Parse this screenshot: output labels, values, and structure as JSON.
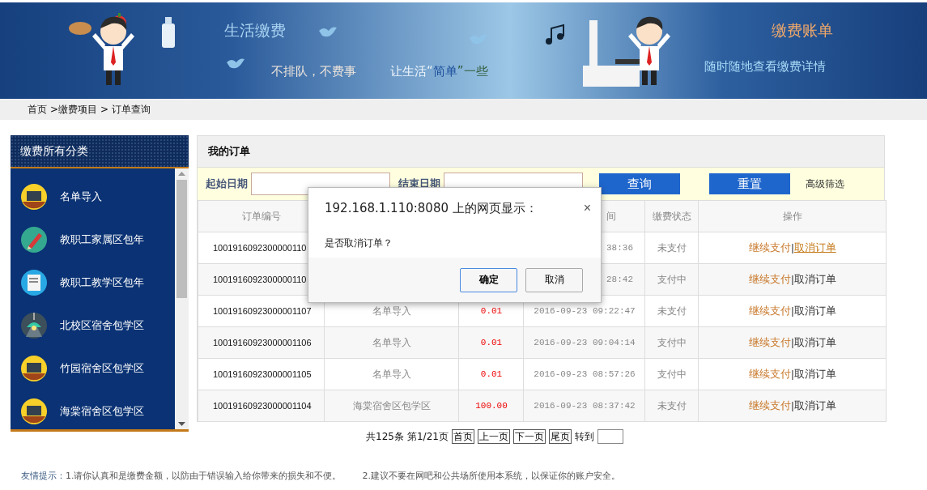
{
  "banner": {
    "title": "生活缴费",
    "slogan_1": "不排队，不费事",
    "slogan_2": [
      {
        "text": "让生活“",
        "color": "#eef4fb"
      },
      {
        "text": "简单",
        "color": "#1d4f9c"
      },
      {
        "text": "”一些",
        "color": "#2f5a36"
      }
    ],
    "right_title": "缴费账单",
    "right_subtitle": "随时随地查看缴费详情"
  },
  "breadcrumb": [
    "首页",
    ">缴费项目",
    ">",
    "订单查询"
  ],
  "sidebar": {
    "title": "缴费所有分类",
    "items": [
      {
        "label": "名单导入",
        "kind": "blackboard"
      },
      {
        "label": "教职工家属区包年",
        "kind": "pencil"
      },
      {
        "label": "教职工教学区包年",
        "kind": "document"
      },
      {
        "label": "北校区宿舍包学区",
        "kind": "lamp"
      },
      {
        "label": "竹园宿舍区包学区",
        "kind": "blackboard"
      },
      {
        "label": "海棠宿舍区包学区",
        "kind": "blackboard"
      }
    ]
  },
  "orders": {
    "title": "我的订单",
    "filter": {
      "start_label": "起始日期",
      "end_label": "结束日期",
      "search_button": "查询",
      "reset_button": "重置",
      "advanced": "高级筛选"
    },
    "columns": [
      {
        "label": "订单编号"
      },
      {},
      {},
      {
        "label": "间",
        "clipped": true
      },
      {
        "label": "缴费状态"
      },
      {
        "label": "操作"
      }
    ],
    "rows": [
      {
        "id": "1001916092300000110",
        "time": "38:36",
        "time_clipped": true,
        "status": "未支付",
        "separator": "|",
        "actions": [
          {
            "label": "继续支付",
            "hovered": false
          },
          {
            "label": "取消订单",
            "hovered": true
          }
        ]
      },
      {
        "id": "1001916092300000110",
        "time": "28:42",
        "time_clipped": true,
        "status": "支付中",
        "separator": "|",
        "actions": [
          {
            "label": "继续支付",
            "hovered": false
          },
          {
            "label": "取消订单",
            "hovered": false
          }
        ]
      },
      {
        "id": "10019160923000001107",
        "item": "名单导入",
        "amount": "0.01",
        "time": "2016-09-23 09:22:47",
        "status": "未支付",
        "separator": "|",
        "actions": [
          {
            "label": "继续支付",
            "hovered": false
          },
          {
            "label": "取消订单",
            "hovered": false
          }
        ]
      },
      {
        "id": "10019160923000001106",
        "item": "名单导入",
        "amount": "0.01",
        "time": "2016-09-23 09:04:14",
        "status": "支付中",
        "separator": "|",
        "actions": [
          {
            "label": "继续支付",
            "hovered": false
          },
          {
            "label": "取消订单",
            "hovered": false
          }
        ]
      },
      {
        "id": "10019160923000001105",
        "item": "名单导入",
        "amount": "0.01",
        "time": "2016-09-23 08:57:26",
        "status": "支付中",
        "separator": "|",
        "actions": [
          {
            "label": "继续支付",
            "hovered": false
          },
          {
            "label": "取消订单",
            "hovered": false
          }
        ]
      },
      {
        "id": "10019160923000001104",
        "item": "海棠宿舍区包学区",
        "amount": "100.00",
        "time": "2016-09-23 08:37:42",
        "status": "未支付",
        "separator": "|",
        "actions": [
          {
            "label": "继续支付",
            "hovered": false
          },
          {
            "label": "取消订单",
            "hovered": false
          }
        ]
      }
    ],
    "pagination": {
      "total": "共125条",
      "page": "第1/21页",
      "buttons": [
        "首页",
        "上一页",
        "下一页",
        "尾页"
      ],
      "goto": "转到"
    }
  },
  "tips": {
    "label": "友情提示：",
    "items": [
      "1.请你认真和是缴费金额，以防由于错误输入给你带来的损失和不便。",
      "2.建议不要在网吧和公共场所使用本系统，以保证你的账户安全。"
    ]
  },
  "dialog": {
    "title": "192.168.1.110:8080 上的网页显示：",
    "close": "×",
    "message": "是否取消订单？",
    "buttons": [
      {
        "label": "确定",
        "selected": true
      },
      {
        "label": "取消",
        "selected": false
      }
    ]
  }
}
